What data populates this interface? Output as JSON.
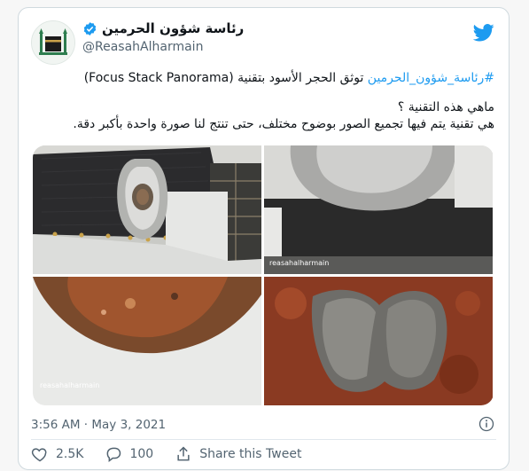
{
  "account": {
    "display_name": "رئاسة شؤون الحرمين",
    "handle": "@ReasahAlharmain",
    "verified": true,
    "avatar": "kaaba-logo"
  },
  "tweet": {
    "hashtag": "#رئاسة_شؤون_الحرمين",
    "line1_rest": " توثق الحجر الأسود بتقنية (Focus Stack Panorama)",
    "question": "ماهي هذه التقنية ؟",
    "answer": "هي تقنية يتم فيها تجميع الصور بوضوح مختلف، حتى تنتج لنا صورة واحدة بأكبر دقة."
  },
  "media": {
    "watermark": "reasahalharmain",
    "image_count": 4
  },
  "meta": {
    "timestamp": "3:56 AM · May 3, 2021"
  },
  "actions": {
    "likes": "2.5K",
    "replies": "100",
    "share_label": "Share this Tweet"
  },
  "colors": {
    "accent": "#1d9bf0",
    "like_red": "#e0245e",
    "muted": "#536471"
  }
}
